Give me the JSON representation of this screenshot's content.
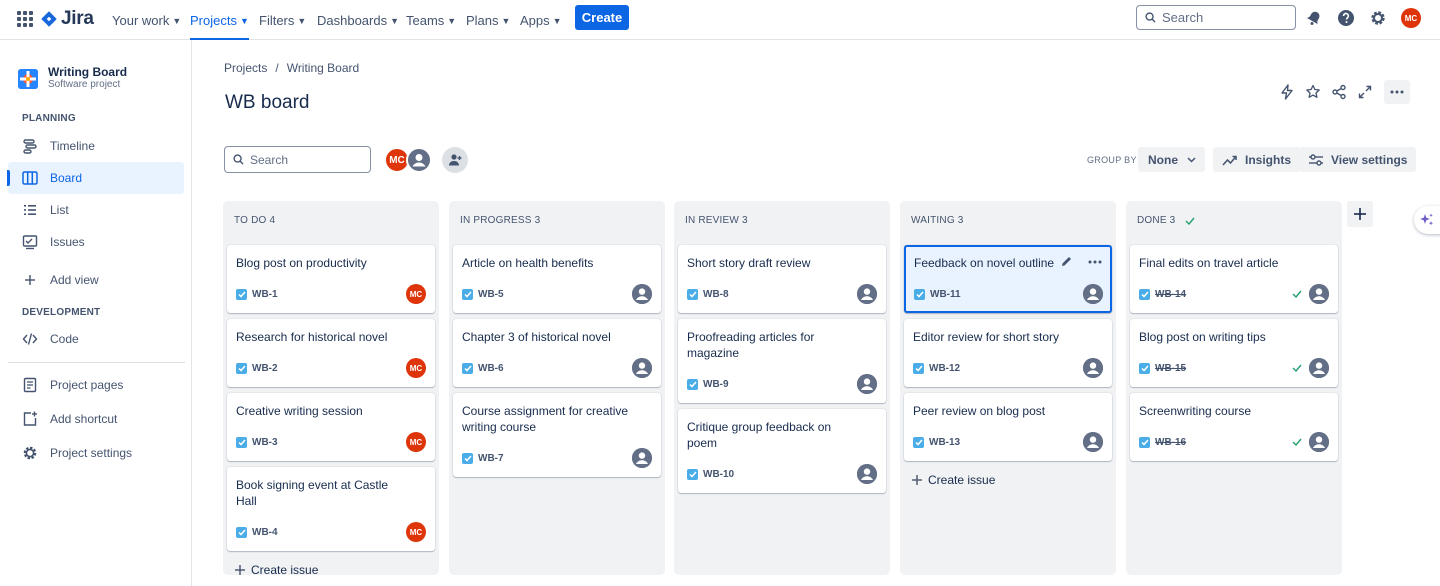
{
  "topnav": {
    "logo_text": "Jira",
    "items": [
      {
        "label": "Your work"
      },
      {
        "label": "Projects"
      },
      {
        "label": "Filters"
      },
      {
        "label": "Dashboards"
      },
      {
        "label": "Teams"
      },
      {
        "label": "Plans"
      },
      {
        "label": "Apps"
      }
    ],
    "create_label": "Create",
    "search_placeholder": "Search",
    "user_initials": "MC"
  },
  "sidebar": {
    "project_name": "Writing Board",
    "project_type": "Software project",
    "planning_heading": "PLANNING",
    "planning_items": [
      {
        "label": "Timeline",
        "icon": "timeline-icon"
      },
      {
        "label": "Board",
        "icon": "board-icon"
      },
      {
        "label": "List",
        "icon": "list-icon"
      },
      {
        "label": "Issues",
        "icon": "issues-icon"
      },
      {
        "label": "Add view",
        "icon": "plus-icon"
      }
    ],
    "development_heading": "DEVELOPMENT",
    "development_items": [
      {
        "label": "Code",
        "icon": "code-icon"
      }
    ],
    "footer_items": [
      {
        "label": "Project pages",
        "icon": "page-icon"
      },
      {
        "label": "Add shortcut",
        "icon": "shortcut-icon"
      },
      {
        "label": "Project settings",
        "icon": "gear-icon"
      }
    ]
  },
  "main": {
    "breadcrumbs": [
      "Projects",
      "/",
      "Writing Board"
    ],
    "title": "WB board",
    "search_placeholder": "Search",
    "avatar_initials": "MC",
    "group_by_label": "GROUP BY",
    "group_by_value": "None",
    "insights_label": "Insights",
    "view_settings_label": "View settings"
  },
  "columns": [
    {
      "title": "TO DO 4",
      "create_label": "Create issue",
      "cards": [
        {
          "title": "Blog post on productivity",
          "key": "WB-1",
          "assignee": "MC"
        },
        {
          "title": "Research for historical novel",
          "key": "WB-2",
          "assignee": "MC"
        },
        {
          "title": "Creative writing session",
          "key": "WB-3",
          "assignee": "MC"
        },
        {
          "title": "Book signing event at Castle Hall",
          "key": "WB-4",
          "assignee": "MC"
        }
      ]
    },
    {
      "title": "IN PROGRESS 3",
      "cards": [
        {
          "title": "Article on health benefits",
          "key": "WB-5",
          "assignee": ""
        },
        {
          "title": "Chapter 3 of historical novel",
          "key": "WB-6",
          "assignee": ""
        },
        {
          "title": "Course assignment for creative writing course",
          "key": "WB-7",
          "assignee": ""
        }
      ]
    },
    {
      "title": "IN REVIEW 3",
      "cards": [
        {
          "title": "Short story draft review",
          "key": "WB-8",
          "assignee": ""
        },
        {
          "title": "Proofreading articles for magazine",
          "key": "WB-9",
          "assignee": ""
        },
        {
          "title": "Critique group feedback on poem",
          "key": "WB-10",
          "assignee": ""
        }
      ]
    },
    {
      "title": "WAITING 3",
      "create_label": "Create issue",
      "cards": [
        {
          "title": "Feedback on novel outline",
          "key": "WB-11",
          "assignee": "",
          "selected": true
        },
        {
          "title": "Editor review for short story",
          "key": "WB-12",
          "assignee": ""
        },
        {
          "title": "Peer review on blog post",
          "key": "WB-13",
          "assignee": ""
        }
      ]
    },
    {
      "title": "DONE 3",
      "done": true,
      "cards": [
        {
          "title": "Final edits on travel article",
          "key": "WB-14",
          "assignee": ""
        },
        {
          "title": "Blog post on writing tips",
          "key": "WB-15",
          "assignee": ""
        },
        {
          "title": "Screenwriting course",
          "key": "WB-16",
          "assignee": ""
        }
      ]
    }
  ],
  "colors": {
    "accent": "#0c66e4",
    "avatar": "#de350b",
    "column_bg": "#f1f2f4",
    "done_check": "#22a06b"
  }
}
